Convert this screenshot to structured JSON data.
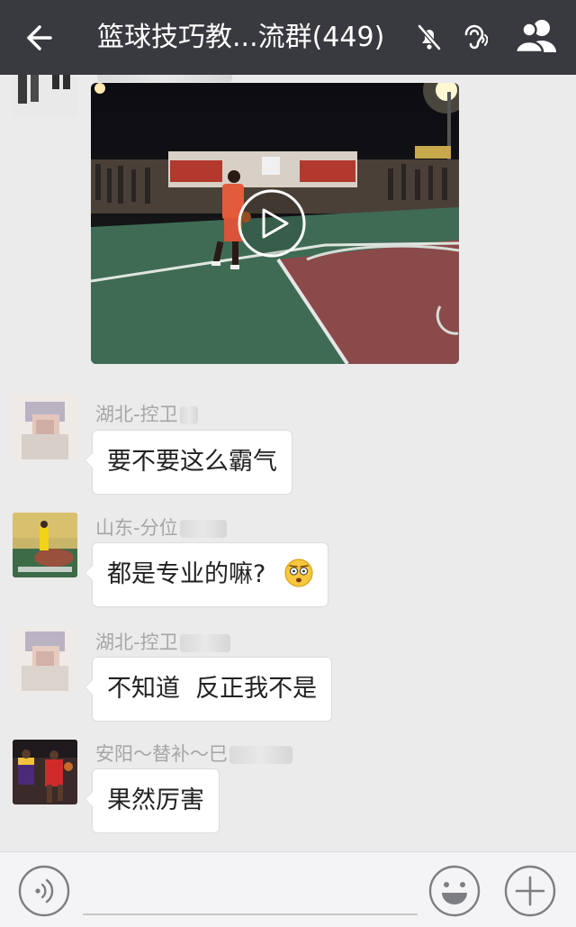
{
  "header": {
    "title": "篮球技巧教...流群(449)"
  },
  "messages": [
    {
      "sender": "湖北-控卫",
      "text": "要不要这么霸气"
    },
    {
      "sender": "山东-分位",
      "text": "都是专业的嘛?",
      "emoji": "surprised-face-emoji"
    },
    {
      "sender": "湖北-控卫",
      "text": "不知道  反正我不是"
    },
    {
      "sender": "安阳～替补～巳",
      "text": "果然厉害"
    }
  ],
  "icons": {
    "back": "back-arrow-icon",
    "mute": "mute-bell-icon",
    "ear": "earpiece-icon",
    "group": "group-members-icon",
    "voice": "voice-input-icon",
    "smile": "emoji-icon",
    "plus": "more-plus-icon",
    "play": "play-icon"
  },
  "colors": {
    "header_bg": "#393a3f",
    "chat_bg": "#ebebeb",
    "court_green": "#3f6b55",
    "court_red": "#8a4a4a"
  }
}
